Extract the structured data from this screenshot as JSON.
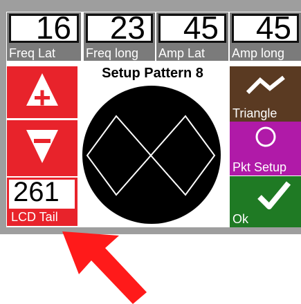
{
  "params": [
    {
      "value": "16",
      "label": "Freq Lat"
    },
    {
      "value": "23",
      "label": "Freq long"
    },
    {
      "value": "45",
      "label": "Amp Lat"
    },
    {
      "value": "45",
      "label": "Amp long"
    }
  ],
  "title": "Setup Pattern 8",
  "controls": {
    "increase_icon": "plus-icon",
    "decrease_icon": "minus-icon"
  },
  "lcd": {
    "value": "261",
    "label": "LCD Tail"
  },
  "right_buttons": {
    "triangle": {
      "label": "Triangle",
      "icon": "wave-icon",
      "color": "#5a3a22"
    },
    "pkt_setup": {
      "label": "Pkt Setup",
      "icon": "circle-icon",
      "color": "#b01aa8"
    },
    "ok": {
      "label": "Ok",
      "icon": "checkmark-icon",
      "color": "#1f7a24"
    }
  },
  "colors": {
    "red": "#e8232b",
    "arrow": "#ff1a1a"
  }
}
